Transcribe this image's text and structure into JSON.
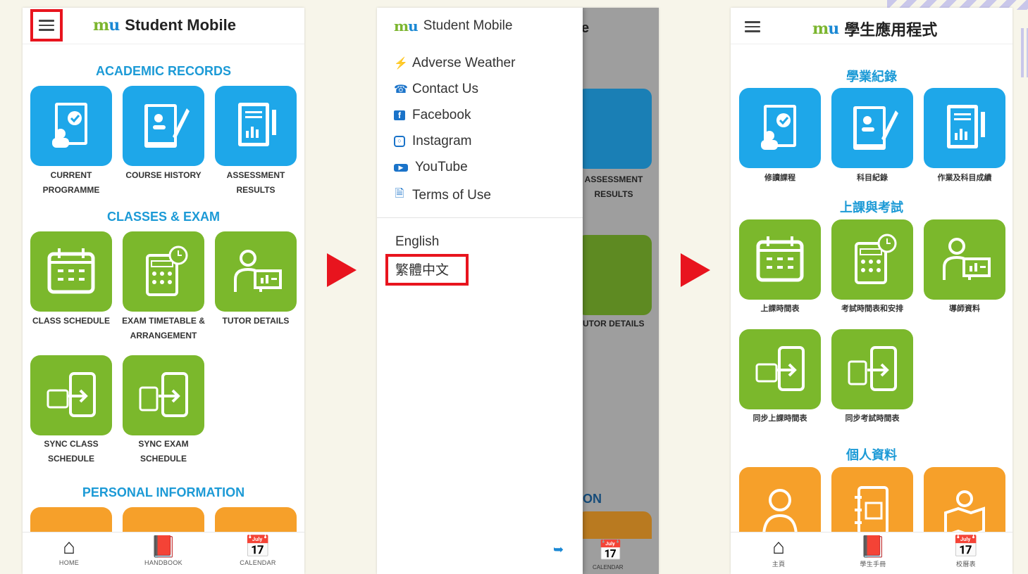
{
  "colors": {
    "blue_tile": "#1ea7e9",
    "green_tile": "#7bb82c",
    "orange_tile": "#f6a02a",
    "section_title": "#1c9ad6",
    "highlight": "#e8141e"
  },
  "screen1": {
    "logo": "mu",
    "title": "Student Mobile",
    "sections": {
      "academic": "ACADEMIC RECORDS",
      "classes": "CLASSES & EXAM",
      "personal": "PERSONAL INFORMATION"
    },
    "tiles": {
      "current_programme": "CURRENT PROGRAMME",
      "course_history": "COURSE HISTORY",
      "assessment_results": "ASSESSMENT RESULTS",
      "class_schedule": "CLASS SCHEDULE",
      "exam_timetable": "EXAM TIMETABLE & ARRANGEMENT",
      "tutor_details": "TUTOR DETAILS",
      "sync_class": "SYNC CLASS SCHEDULE",
      "sync_exam": "SYNC EXAM SCHEDULE"
    },
    "nav": {
      "home": "HOME",
      "handbook": "HANDBOOK",
      "calendar": "CALENDAR"
    }
  },
  "screen2": {
    "logo": "mu",
    "title": "Student Mobile",
    "menu": {
      "adverse_weather": "Adverse Weather",
      "contact_us": "Contact Us",
      "facebook": "Facebook",
      "instagram": "Instagram",
      "youtube": "YouTube",
      "terms": "Terms of Use"
    },
    "languages": {
      "english": "English",
      "chinese": "繁體中文"
    },
    "behind": {
      "assessment": "ASSESSMENT RESULTS",
      "tutor": "UTOR DETAILS",
      "section_partial": "ON",
      "title_partial": "e",
      "calendar": "CALENDAR"
    }
  },
  "screen3": {
    "logo": "mu",
    "title": "學生應用程式",
    "sections": {
      "academic": "學業紀錄",
      "classes": "上課與考試",
      "personal": "個人資料"
    },
    "tiles": {
      "current_programme": "修讀課程",
      "course_history": "科目紀錄",
      "assessment_results": "作業及科目成績",
      "class_schedule": "上課時間表",
      "exam_timetable": "考試時間表和安排",
      "tutor_details": "導師資料",
      "sync_class": "同步上課時間表",
      "sync_exam": "同步考試時間表"
    },
    "nav": {
      "home": "主頁",
      "handbook": "學生手冊",
      "calendar": "校曆表"
    }
  }
}
